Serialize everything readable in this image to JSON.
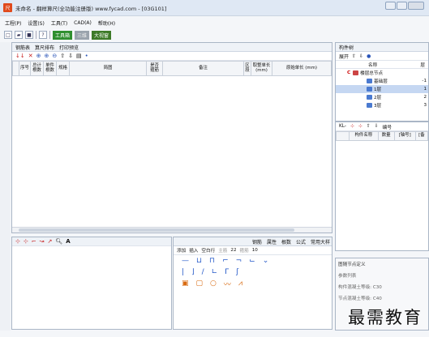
{
  "window": {
    "title": "未命名 - 翻样算尺(全功能注册版) www.fycad.com - [03G101]"
  },
  "menu": [
    "工程(P)",
    "设置(S)",
    "工具(T)",
    "CAD(A)",
    "帮助(H)"
  ],
  "toolbar": {
    "btn_tools": "工具箱",
    "btn_disabled": "三维",
    "btn_big": "大视窗"
  },
  "left_panel": {
    "tabs": [
      "钢筋表",
      "算尺排布",
      "打印预览"
    ],
    "columns": [
      "序号",
      "总计\n根数",
      "单件\n根数",
      "规格",
      "简图",
      "是否\n箍筋",
      "备注",
      "区\n段",
      "取整单长\n(mm)",
      "原始单长\n(mm)"
    ]
  },
  "lower_mid": {
    "tabs": [
      "钢筋",
      "属性",
      "根数",
      "公式",
      "常用大样"
    ],
    "actions": [
      "添加",
      "插入",
      "空白行",
      "主筋",
      "22",
      "箍筋",
      "10"
    ]
  },
  "right_tree": {
    "header": "构件树",
    "tools": [
      "展开"
    ],
    "col_name": "名称",
    "col_floor": "层",
    "root": "楼层总节点",
    "items": [
      {
        "name": "基础层",
        "val": "-1"
      },
      {
        "name": "1层",
        "val": "1"
      },
      {
        "name": "2层",
        "val": "2"
      },
      {
        "name": "3层",
        "val": "3"
      }
    ]
  },
  "right_mid": {
    "prefix": "KL-",
    "field": "编号",
    "columns": [
      "构件名称",
      "数量",
      "[轴号]",
      "[备"
    ]
  },
  "right_bottom": {
    "header": "图随节点定义",
    "param": "参数列表",
    "c30": "构件混凝土等级: C30",
    "c40": "节点混凝土等级: C40"
  },
  "watermark": "最需教育"
}
